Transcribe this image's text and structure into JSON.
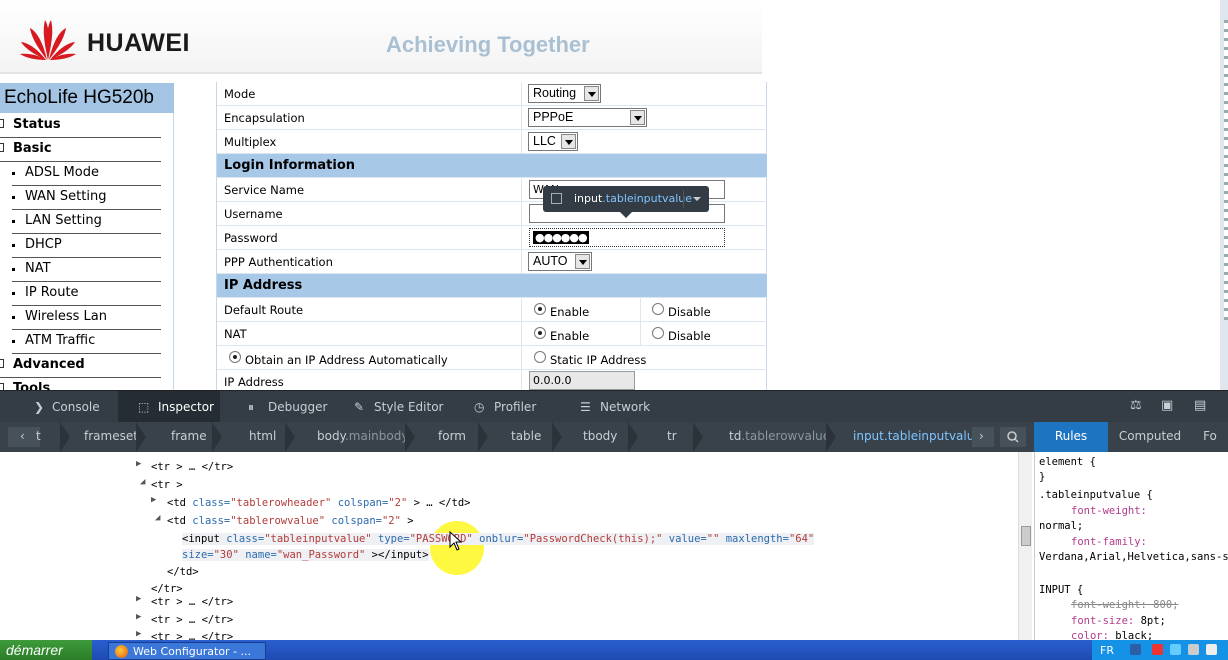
{
  "header": {
    "brand": "HUAWEI",
    "slogan": "Achieving Together",
    "logo_icon": "huawei-petal-logo",
    "brand_color": "#c8102e"
  },
  "nav": {
    "model": "EchoLife HG520b",
    "items": [
      {
        "label": "Status",
        "type": "main"
      },
      {
        "label": "Basic",
        "type": "main"
      },
      {
        "label": "ADSL Mode",
        "type": "sub"
      },
      {
        "label": "WAN Setting",
        "type": "sub"
      },
      {
        "label": "LAN Setting",
        "type": "sub"
      },
      {
        "label": "DHCP",
        "type": "sub"
      },
      {
        "label": "NAT",
        "type": "sub"
      },
      {
        "label": "IP Route",
        "type": "sub"
      },
      {
        "label": "Wireless Lan",
        "type": "sub"
      },
      {
        "label": "ATM Traffic",
        "type": "sub"
      },
      {
        "label": "Advanced",
        "type": "main"
      },
      {
        "label": "Tools",
        "type": "main"
      }
    ]
  },
  "form": {
    "mode_label": "Mode",
    "mode_value": "Routing",
    "encapsulation_label": "Encapsulation",
    "encapsulation_value": "PPPoE",
    "multiplex_label": "Multiplex",
    "multiplex_value": "LLC",
    "login_section": "Login Information",
    "service_name_label": "Service Name",
    "service_name_value": "WAN",
    "username_label": "Username",
    "username_value": "",
    "password_label": "Password",
    "password_value": "●●●●●●",
    "ppp_auth_label": "PPP Authentication",
    "ppp_auth_value": "AUTO",
    "ip_section": "IP Address",
    "default_route_label": "Default Route",
    "nat_label": "NAT",
    "enable_label": "Enable",
    "disable_label": "Disable",
    "obtain_auto_label": "Obtain an IP Address Automatically",
    "static_ip_label": "Static IP Address",
    "ip_address_label": "IP Address",
    "ip_address_value": "0.0.0.0"
  },
  "tooltip": {
    "tag": "input",
    "cls": ".tableinputvalue"
  },
  "devtools": {
    "tabs": [
      "Console",
      "Inspector",
      "Debugger",
      "Style Editor",
      "Profiler",
      "Network"
    ],
    "tab_icons": [
      "console-icon",
      "inspector-icon",
      "debugger-icon",
      "style-editor-icon",
      "profiler-icon",
      "network-icon"
    ],
    "active_tab": "Inspector",
    "breadcrumbs": [
      {
        "tag": "t",
        "cls": ""
      },
      {
        "tag": "frameset",
        "cls": ""
      },
      {
        "tag": "frame",
        "cls": ""
      },
      {
        "tag": "html",
        "cls": ""
      },
      {
        "tag": "body",
        "cls": ".mainbody"
      },
      {
        "tag": "form",
        "cls": ""
      },
      {
        "tag": "table",
        "cls": ""
      },
      {
        "tag": "tbody",
        "cls": ""
      },
      {
        "tag": "tr",
        "cls": ""
      },
      {
        "tag": "td",
        "cls": ".tablerowvalue"
      },
      {
        "tag": "input",
        "cls": ".tableinputvalue"
      }
    ],
    "side_tabs": [
      "Rules",
      "Computed",
      "Fo"
    ],
    "markup": {
      "l1": "<tr > … </tr>",
      "l2": "<tr >",
      "l3a": "<td ",
      "l3_class_attr": "class=",
      "l3_class_val": "\"tablerowheader\"",
      "l3_colspan_attr": " colspan=",
      "l3_colspan_val": "\"2\"",
      "l3_end": " > … </td>",
      "l4a": "<td ",
      "l4_class_attr": "class=",
      "l4_class_val": "\"tablerowvalue\"",
      "l4_colspan_attr": " colspan=",
      "l4_colspan_val": "\"2\"",
      "l4_end": " >",
      "l5a": "<input ",
      "l5_class_attr": "class=",
      "l5_class_val": "\"tableinputvalue\"",
      "l5_type_attr": " type=",
      "l5_type_val": "\"PASSWORD\"",
      "l5_onblur_attr": " onblur=",
      "l5_onblur_val": "\"PasswordCheck(this);\"",
      "l5_value_attr": " value=",
      "l5_value_val": "\"\"",
      "l5_maxlen_attr": " maxlength=",
      "l5_maxlen_val": "\"64\"",
      "l6_size_attr": "size=",
      "l6_size_val": "\"30\"",
      "l6_name_attr": " name=",
      "l6_name_val": "\"wan_Password\"",
      "l6_end": " ></input>",
      "l7": "</td>",
      "l8": "</tr>",
      "l9": "<tr > … </tr>",
      "l10": "<tr > … </tr>",
      "l11": "<tr > … </tr>"
    },
    "rules": {
      "r1": "element {",
      "r2": "}",
      "r3": ".tableinputvalue {",
      "r4_prop": "font-weight",
      "r4_val": "normal;",
      "r5_prop": "font-family",
      "r5_val": "Verdana,Arial,Helvetica,sans-serif;",
      "r6": "INPUT {",
      "r7": "font-weight: 800;",
      "r8_prop": "font-size",
      "r8_val": "8pt;",
      "r9_prop": "color",
      "r9_val": "black;"
    }
  },
  "taskbar": {
    "start_label": "démarrer",
    "task_label": "Web Configurator - ...",
    "lang": "FR"
  }
}
